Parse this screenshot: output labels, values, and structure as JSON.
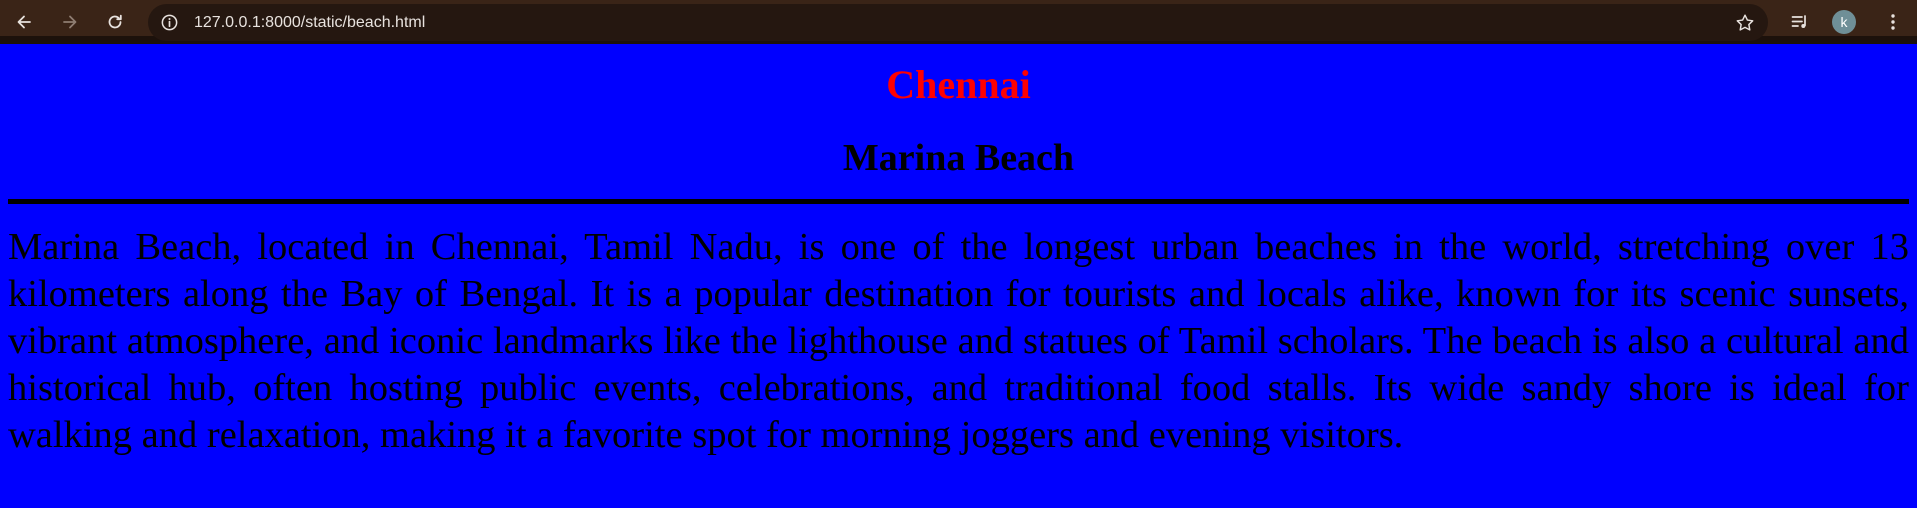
{
  "browser": {
    "url": "127.0.0.1:8000/static/beach.html",
    "profile_initial": "k",
    "icons": {
      "back": "back-arrow-icon",
      "forward": "forward-arrow-icon",
      "reload": "reload-icon",
      "site_info": "info-icon",
      "bookmark": "star-icon",
      "media": "media-control-icon",
      "menu": "kebab-menu-icon"
    }
  },
  "page": {
    "background_color": "#0000ff",
    "city_title": "Chennai",
    "city_title_color": "#ff0000",
    "beach_title": "Marina Beach",
    "description": "Marina Beach, located in Chennai, Tamil Nadu, is one of the longest urban beaches in the world, stretching over 13 kilometers along the Bay of Bengal. It is a popular destination for tourists and locals alike, known for its scenic sunsets, vibrant atmosphere, and iconic landmarks like the lighthouse and statues of Tamil scholars. The beach is also a cultural and historical hub, often hosting public events, celebrations, and traditional food stalls. Its wide sandy shore is ideal for walking and relaxation, making it a favorite spot for morning joggers and evening visitors."
  }
}
